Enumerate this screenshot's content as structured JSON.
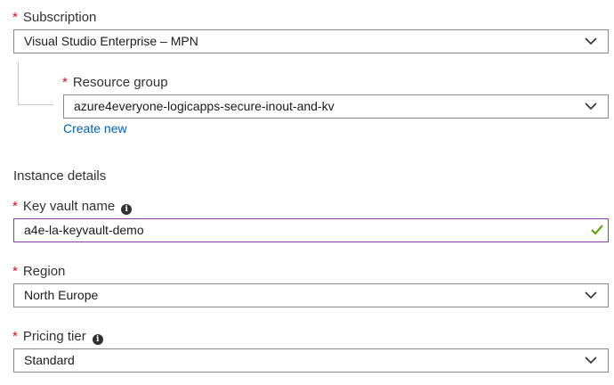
{
  "subscription": {
    "label": "Subscription",
    "value": "Visual Studio Enterprise – MPN"
  },
  "resource_group": {
    "label": "Resource group",
    "value": "azure4everyone-logicapps-secure-inout-and-kv",
    "create_new": "Create new"
  },
  "instance_details": {
    "heading": "Instance details"
  },
  "key_vault_name": {
    "label": "Key vault name",
    "value": "a4e-la-keyvault-demo",
    "info_icon": "info-icon",
    "status_icon": "checkmark-icon",
    "valid_color": "#57a300"
  },
  "region": {
    "label": "Region",
    "value": "North Europe"
  },
  "pricing_tier": {
    "label": "Pricing tier",
    "value": "Standard",
    "info_icon": "info-icon"
  },
  "required_marker": "*",
  "colors": {
    "required": "#e00b1c",
    "link": "#0063b1",
    "focus_border": "#8a3ea5"
  }
}
